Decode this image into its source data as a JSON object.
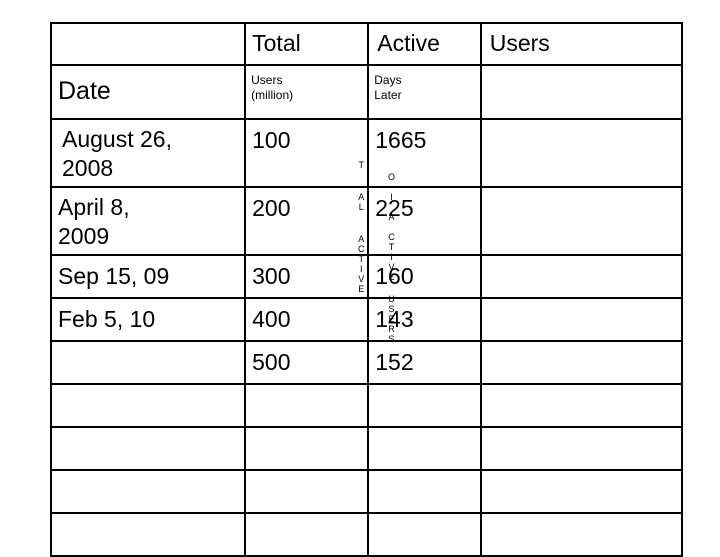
{
  "table": {
    "header_row_1": {
      "col1": "",
      "col2": "Total",
      "col3": "Active",
      "col4": "Users",
      "col5": ""
    },
    "header_row_2": {
      "date": "Date",
      "total_line1": "Users",
      "total_line2": "(million)",
      "active_line1": "Days",
      "active_line2": "Later",
      "col5": ""
    },
    "rows": [
      {
        "date_line1": "August 26,",
        "date_line2": "2008",
        "users": "100",
        "days": "1665",
        "extra": ""
      },
      {
        "date_line1": "April 8,",
        "date_line2": "2009",
        "users": "200",
        "days": "225",
        "extra": ""
      },
      {
        "date_line1": "Sep 15, 09",
        "date_line2": "",
        "users": "300",
        "days": "160",
        "extra": ""
      },
      {
        "date_line1": "Feb 5, 10",
        "date_line2": "",
        "users": "400",
        "days": "143",
        "extra": ""
      },
      {
        "date_line1": "",
        "date_line2": "",
        "users": "500",
        "days": "152",
        "extra": ""
      },
      {
        "date_line1": "",
        "date_line2": "",
        "users": "",
        "days": "",
        "extra": ""
      },
      {
        "date_line1": "",
        "date_line2": "",
        "users": "",
        "days": "",
        "extra": ""
      },
      {
        "date_line1": "",
        "date_line2": "",
        "users": "",
        "days": "",
        "extra": ""
      },
      {
        "date_line1": "",
        "date_line2": "",
        "users": "",
        "days": "",
        "extra": ""
      }
    ]
  },
  "watermark": {
    "column_a": "TAL ACTIVE",
    "column_b": "OTAL ACTIVE USERS",
    "letters_a": [
      "T",
      "A",
      "L",
      "A",
      "C",
      "T",
      "I",
      "V",
      "E"
    ],
    "letters_b": [
      "O",
      "I",
      "A",
      "C",
      "T",
      "I",
      "V",
      "E",
      "U",
      "S",
      "E",
      "R",
      "S"
    ]
  }
}
